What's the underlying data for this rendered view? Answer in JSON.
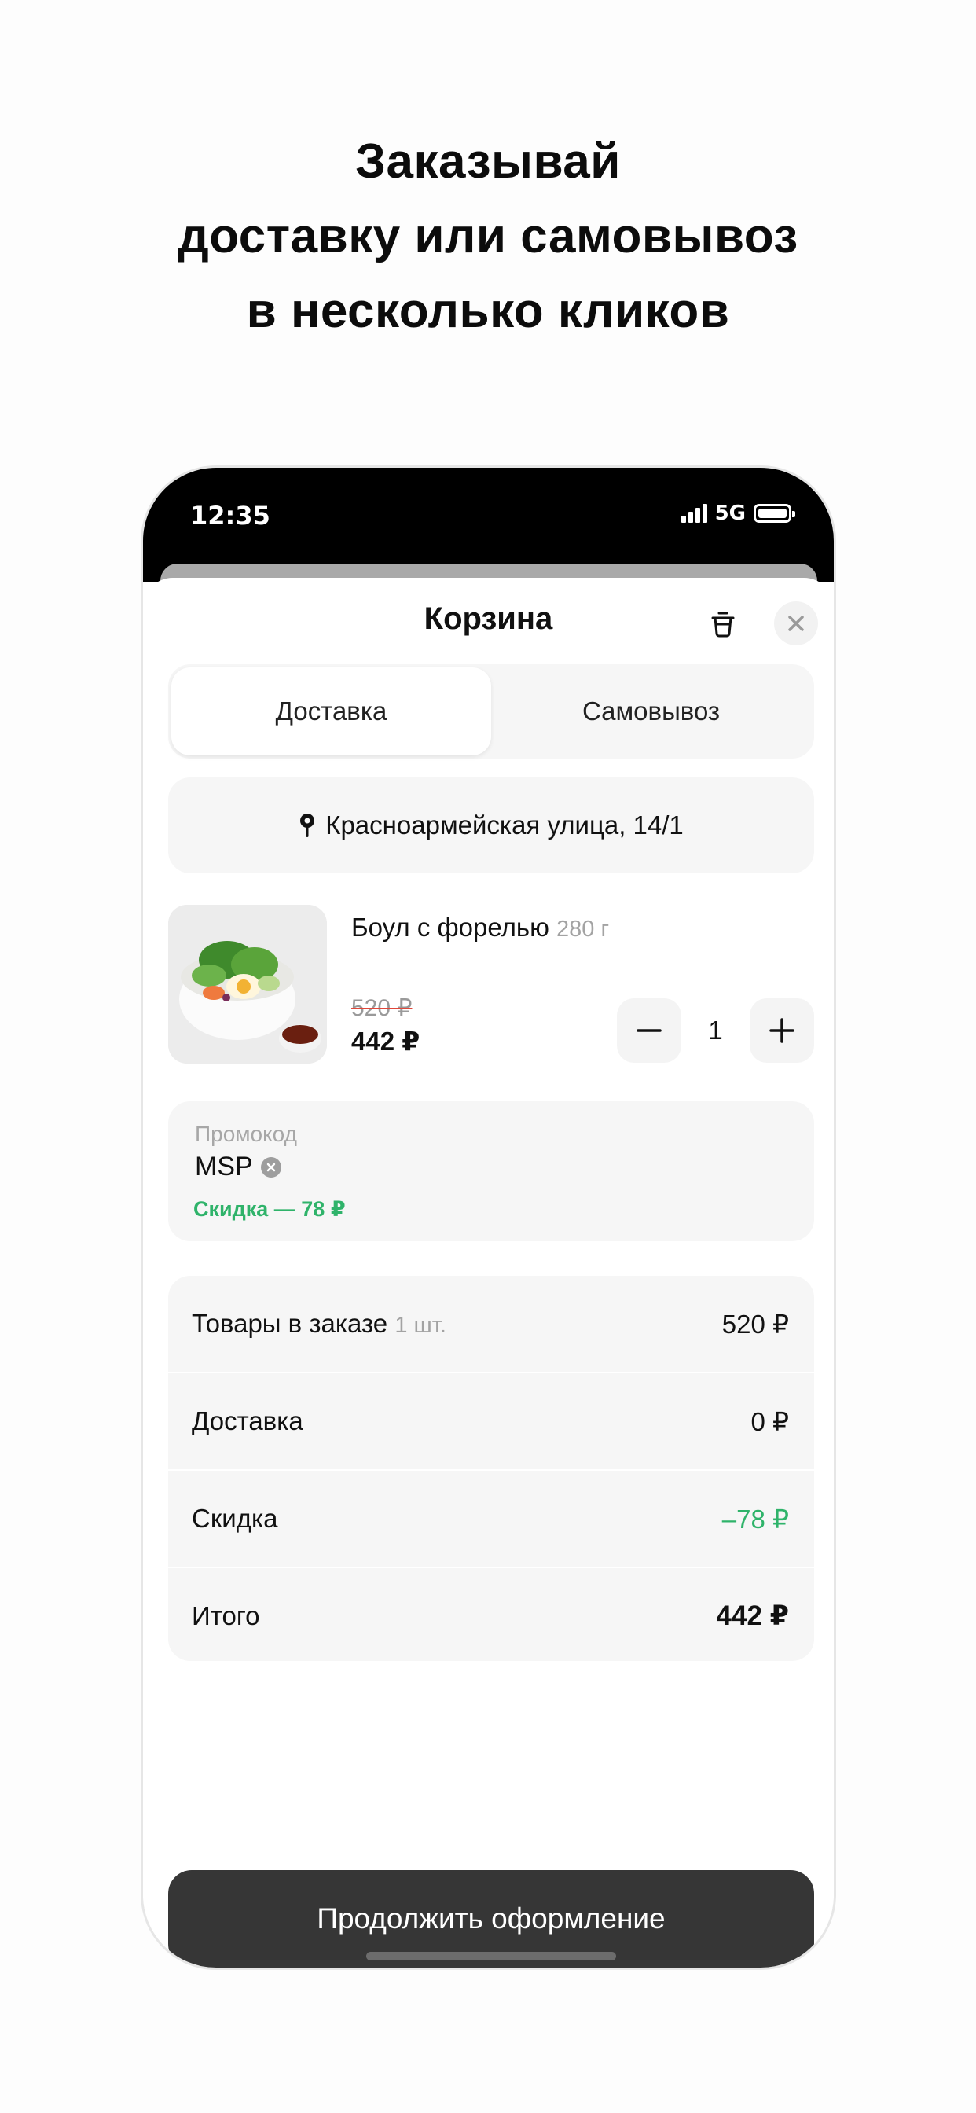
{
  "headline": {
    "line1": "Заказывай",
    "line2": "доставку или самовывоз",
    "line3": "в несколько кликов"
  },
  "status_bar": {
    "time": "12:35",
    "network": "5G"
  },
  "cart": {
    "title": "Корзина",
    "tabs": [
      {
        "label": "Доставка",
        "active": true
      },
      {
        "label": "Самовывоз",
        "active": false
      }
    ],
    "address": "Красноармейская улица, 14/1",
    "item": {
      "name": "Боул с форелью",
      "weight": "280 г",
      "old_price": "520 ₽",
      "new_price": "442 ₽",
      "quantity": "1"
    },
    "promo": {
      "label": "Промокод",
      "code": "MSP",
      "discount_text": "Скидка — 78 ₽"
    },
    "summary": {
      "items_label": "Товары в заказе",
      "items_count": "1 шт.",
      "items_value": "520 ₽",
      "delivery_label": "Доставка",
      "delivery_value": "0 ₽",
      "discount_label": "Скидка",
      "discount_value": "–78 ₽",
      "total_label": "Итого",
      "total_value": "442 ₽"
    },
    "cta_label": "Продолжить оформление"
  },
  "colors": {
    "accent_green": "#2fb36a",
    "cta_bg": "#363636",
    "strike_red": "#e0473a"
  },
  "icons": [
    "signal-icon",
    "battery-icon",
    "trash-icon",
    "close-icon",
    "location-pin-icon",
    "minus-icon",
    "plus-icon",
    "clear-icon"
  ]
}
